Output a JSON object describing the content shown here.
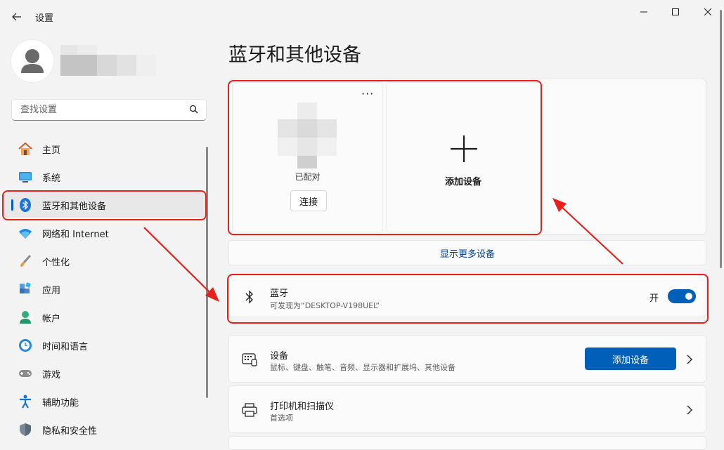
{
  "window": {
    "title": "设置"
  },
  "search": {
    "placeholder": "查找设置"
  },
  "nav": [
    {
      "label": "主页",
      "icon": "home-icon"
    },
    {
      "label": "系统",
      "icon": "system-icon"
    },
    {
      "label": "蓝牙和其他设备",
      "icon": "bluetooth-icon",
      "active": true
    },
    {
      "label": "网络和 Internet",
      "icon": "wifi-icon"
    },
    {
      "label": "个性化",
      "icon": "brush-icon"
    },
    {
      "label": "应用",
      "icon": "apps-icon"
    },
    {
      "label": "帐户",
      "icon": "account-icon"
    },
    {
      "label": "时间和语言",
      "icon": "clock-globe-icon"
    },
    {
      "label": "游戏",
      "icon": "gamepad-icon"
    },
    {
      "label": "辅助功能",
      "icon": "accessibility-icon"
    },
    {
      "label": "隐私和安全性",
      "icon": "shield-icon"
    }
  ],
  "main": {
    "title": "蓝牙和其他设备",
    "device_card": {
      "status": "已配对",
      "connect_label": "连接",
      "more_label": "···"
    },
    "add_card": {
      "label": "添加设备"
    },
    "show_more": "显示更多设备",
    "bluetooth": {
      "title": "蓝牙",
      "subtitle": "可发现为“DESKTOP-V198UEL”",
      "toggle_label": "开",
      "toggle_on": true
    },
    "devices": {
      "title": "设备",
      "subtitle": "鼠标、键盘、触笔、音频、显示器和扩展坞、其他设备",
      "button": "添加设备"
    },
    "printers": {
      "title": "打印机和扫描仪",
      "subtitle": "首选项"
    }
  },
  "colors": {
    "accent": "#005fb8",
    "annotation": "#e8201a",
    "link": "#003e92"
  }
}
